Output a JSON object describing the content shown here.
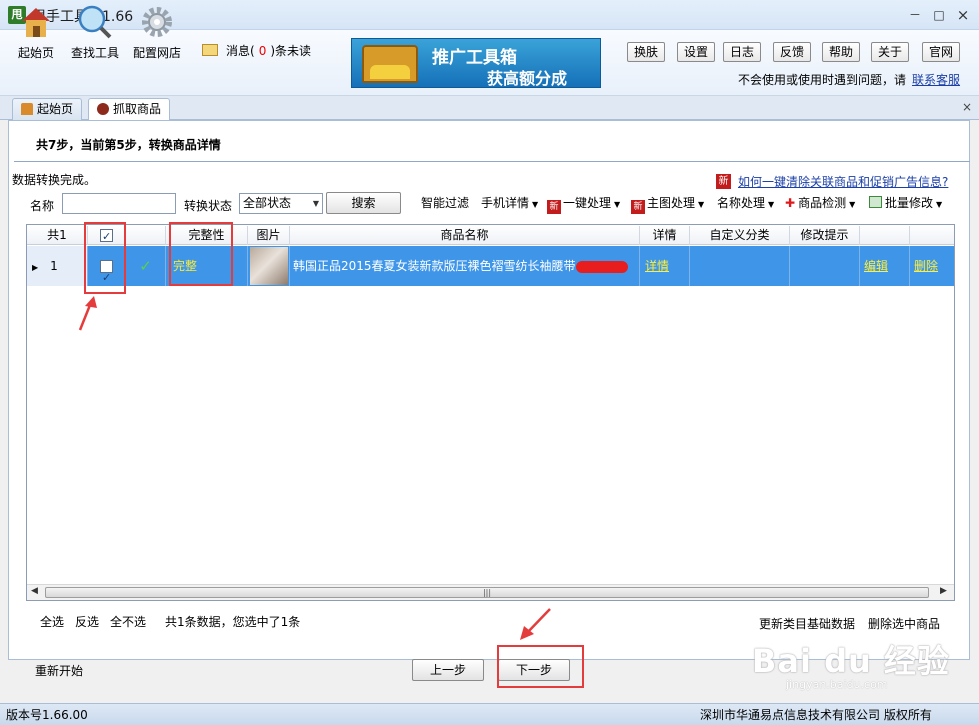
{
  "window": {
    "title": "甩手工具箱1.66",
    "logo_char": "甩",
    "minimize": "－",
    "maximize": "□",
    "close": "×"
  },
  "toolbar": {
    "tools": [
      {
        "label": "起始页",
        "icon": "home-icon"
      },
      {
        "label": "查找工具",
        "icon": "magnifier-icon"
      },
      {
        "label": "配置网店",
        "icon": "gear-icon"
      }
    ],
    "message_prefix": "消息(",
    "message_count": "0",
    "message_suffix": ")条未读",
    "banner_line1": "推广工具箱",
    "banner_line2": "获高额分成",
    "buttons": [
      "换肤",
      "设置",
      "日志",
      "反馈",
      "帮助",
      "关于",
      "官网"
    ],
    "help_text": "不会使用或使用时遇到问题，请",
    "help_link": "联系客服"
  },
  "tabs": [
    {
      "label": "起始页",
      "icon": "home-icon"
    },
    {
      "label": "抓取商品",
      "icon": "grab-icon"
    }
  ],
  "step_text": "共7步，当前第5步，转换商品详情",
  "done_text": "数据转换完成。",
  "news": {
    "badge": "新",
    "link": "如何一键清除关联商品和促销广告信息?"
  },
  "filters": {
    "name_label": "名称",
    "name_value": "",
    "status_label": "转换状态",
    "status_value": "全部状态",
    "search_label": "搜索"
  },
  "action_toolbar": {
    "smart_filter": "智能过滤",
    "mobile_detail": "手机详情",
    "one_click": "一键处理",
    "main_image": "主图处理",
    "name_process": "名称处理",
    "product_check": "商品检测",
    "batch_edit": "批量修改",
    "new_badge": "新"
  },
  "table": {
    "headers": {
      "count": "共1",
      "complete": "完整性",
      "image": "图片",
      "name": "商品名称",
      "detail": "详情",
      "category": "自定义分类",
      "hint": "修改提示"
    },
    "rows": [
      {
        "index": "1",
        "checked": true,
        "status_icon": "check-icon",
        "complete": "完整",
        "name": "韩国正品2015春夏女装新款版压裸色褶雪纺长袖腰带",
        "detail": "详情",
        "category": "",
        "hint": "",
        "edit": "编辑",
        "delete": "删除"
      }
    ],
    "scroll_grip": "|||"
  },
  "bottom": {
    "select_all": "全选",
    "invert": "反选",
    "select_none": "全不选",
    "summary": "共1条数据，您选中了1条",
    "update_category": "更新类目基础数据",
    "delete_selected": "删除选中商品",
    "restart": "重新开始",
    "prev": "上一步",
    "next": "下一步"
  },
  "status": {
    "version": "版本号1.66.00",
    "copyright": "深圳市华通易点信息技术有限公司 版权所有"
  },
  "watermark": {
    "text": "Bai du 经验",
    "url": "jingyan.baidu.com"
  }
}
